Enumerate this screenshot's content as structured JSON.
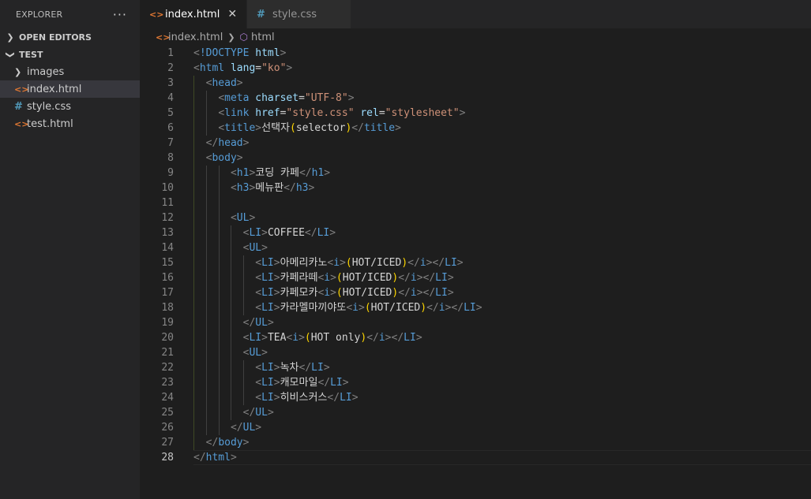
{
  "sidebar": {
    "title": "EXPLORER",
    "more": "···",
    "open_editors": "OPEN EDITORS",
    "folder": "TEST",
    "items": [
      {
        "label": "images",
        "icon": "chevron-right-icon",
        "type": "folder"
      },
      {
        "label": "index.html",
        "icon": "html-file-icon",
        "type": "html"
      },
      {
        "label": "style.css",
        "icon": "css-file-icon",
        "type": "css"
      },
      {
        "label": "test.html",
        "icon": "html-file-icon",
        "type": "html"
      }
    ]
  },
  "tabs": [
    {
      "label": "index.html",
      "close": "✕"
    },
    {
      "label": "style.css"
    }
  ],
  "breadcrumb": {
    "file": "index.html",
    "symbol": "html"
  },
  "editor": {
    "lines": [
      "<!DOCTYPE html>",
      "<html lang=\"ko\">",
      "  <head>",
      "    <meta charset=\"UTF-8\">",
      "    <link href=\"style.css\" rel=\"stylesheet\">",
      "    <title>선택자(selector)</title>",
      "  </head>",
      "  <body>",
      "      <h1>코딩 카페</h1>",
      "      <h3>메뉴판</h3>",
      "",
      "      <UL>",
      "        <LI>COFFEE</LI>",
      "        <UL>",
      "          <LI>아메리카노<i>(HOT/ICED)</i></LI>",
      "          <LI>카페라떼<i>(HOT/ICED)</i></LI>",
      "          <LI>카페모카<i>(HOT/ICED)</i></LI>",
      "          <LI>카라멜마끼야또<i>(HOT/ICED)</i></LI>",
      "        </UL>",
      "        <LI>TEA<i>(HOT only)</i></LI>",
      "        <UL>",
      "          <LI>녹차</LI>",
      "          <LI>캐모마일</LI>",
      "          <LI>히비스커스</LI>",
      "        </UL>",
      "      </UL>",
      "  </body>",
      "</html>"
    ],
    "current_line": 28
  }
}
